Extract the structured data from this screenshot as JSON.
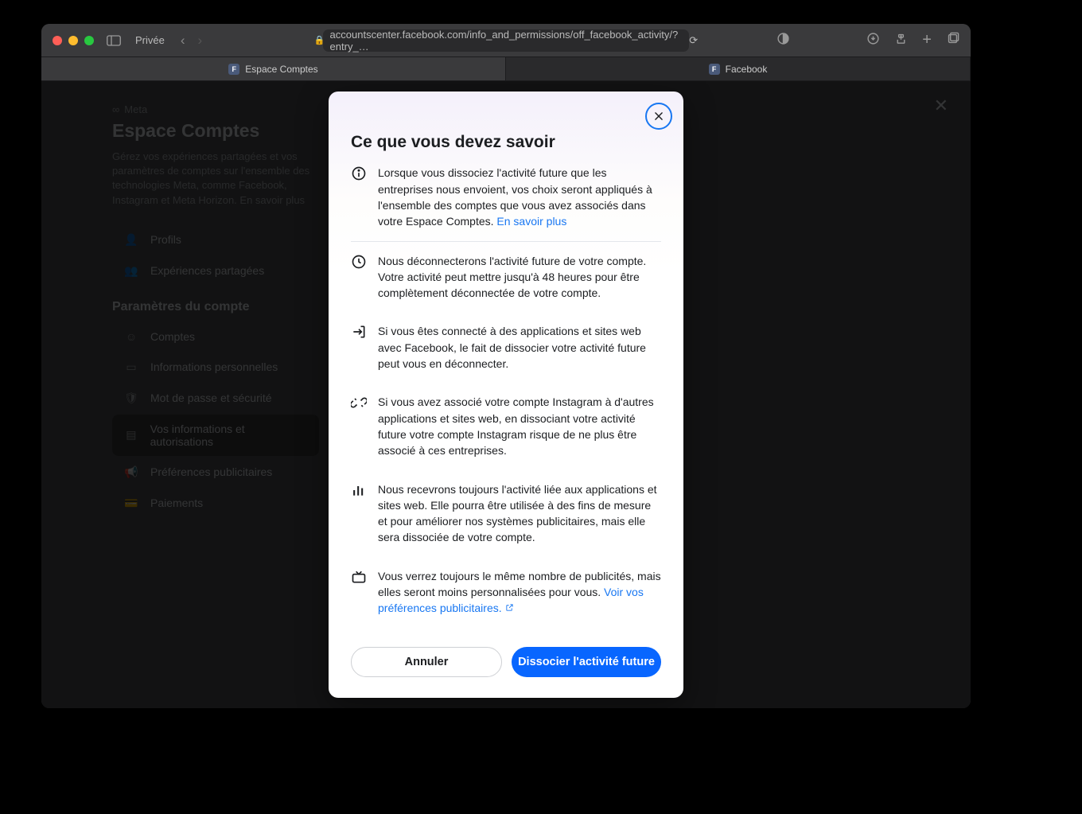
{
  "browser": {
    "private_label": "Privée",
    "url": "accountscenter.facebook.com/info_and_permissions/off_facebook_activity/?entry_…",
    "tabs": [
      {
        "label": "Espace Comptes",
        "active": true
      },
      {
        "label": "Facebook",
        "active": false
      }
    ]
  },
  "background": {
    "meta_brand": "Meta",
    "title": "Espace Comptes",
    "description": "Gérez vos expériences partagées et vos paramètres de comptes sur l'ensemble des technologies Meta, comme Facebook, Instagram et Meta Horizon. En savoir plus",
    "main_heading": "Vos informations et autorisations",
    "sidebar_top": [
      {
        "label": "Profils"
      },
      {
        "label": "Expériences partagées"
      }
    ],
    "sidebar_section_label": "Paramètres du compte",
    "sidebar_settings": [
      {
        "label": "Comptes"
      },
      {
        "label": "Informations personnelles"
      },
      {
        "label": "Mot de passe et sécurité"
      },
      {
        "label": "Vos informations et autorisations"
      },
      {
        "label": "Préférences publicitaires"
      },
      {
        "label": "Paiements"
      }
    ]
  },
  "modal": {
    "title": "Ce que vous devez savoir",
    "items": [
      {
        "icon": "info",
        "text": "Lorsque vous dissociez l'activité future que les entreprises nous envoient, vos choix seront appliqués à l'ensemble des comptes que vous avez associés dans votre Espace Comptes. ",
        "link": "En savoir plus"
      },
      {
        "icon": "clock",
        "text": "Nous déconnecterons l'activité future de votre compte. Votre activité peut mettre jusqu'à 48 heures pour être complètement déconnectée de votre compte."
      },
      {
        "icon": "logout",
        "text": "Si vous êtes connecté à des applications et sites web avec Facebook, le fait de dissocier votre activité future peut vous en déconnecter."
      },
      {
        "icon": "unlink",
        "text": "Si vous avez associé votre compte Instagram à d'autres applications et sites web, en dissociant votre activité future votre compte Instagram risque de ne plus être associé à ces entreprises."
      },
      {
        "icon": "bars",
        "text": "Nous recevrons toujours l'activité liée aux applications et sites web. Elle pourra être utilisée à des fins de mesure et pour améliorer nos systèmes publicitaires, mais elle sera dissociée de votre compte."
      },
      {
        "icon": "tv",
        "text": "Vous verrez toujours le même nombre de publicités, mais elles seront moins personnalisées pour vous. ",
        "link": "Voir vos préférences publicitaires."
      }
    ],
    "cancel_label": "Annuler",
    "confirm_label": "Dissocier l'activité future"
  }
}
